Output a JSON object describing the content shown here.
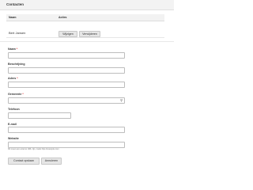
{
  "panel": {
    "title": "Contacten"
  },
  "table": {
    "headers": {
      "name": "Naam",
      "actions": "Acties"
    },
    "rows": [
      {
        "name": "Bert Jansen",
        "edit_label": "Wijzigen",
        "delete_label": "Verwijderen"
      }
    ]
  },
  "form": {
    "name_label": "Naam",
    "description_label": "Beschrijving",
    "address_label": "Adres",
    "municipality_label": "Gemeente",
    "phone_label": "Telefoon",
    "email_label": "E-mail",
    "website_label": "Website",
    "required_marker": "*",
    "website_hint": "Dit moet een externe URL zijn, zoals http://example.com",
    "save_label": "Contact opslaan",
    "cancel_label": "Annuleren"
  },
  "icons": {
    "municipality_select": "search-icon"
  }
}
